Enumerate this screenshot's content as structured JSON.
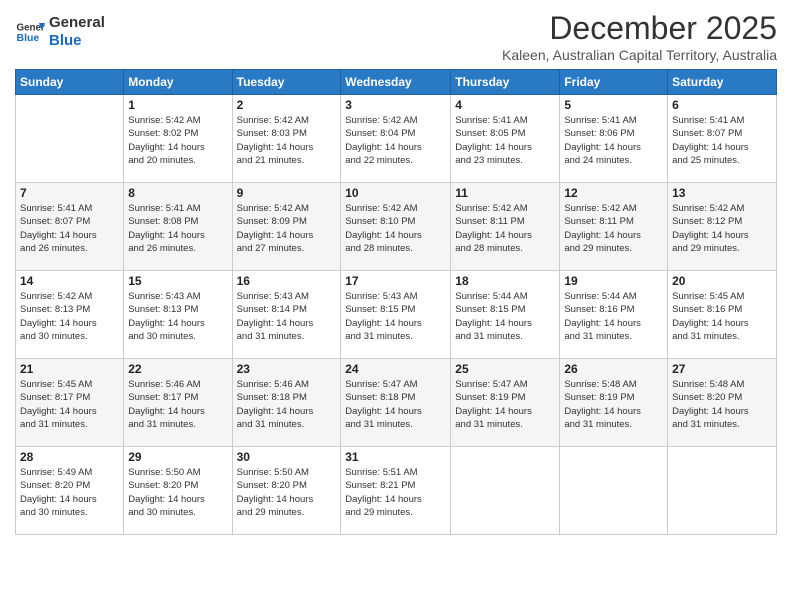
{
  "header": {
    "logo_line1": "General",
    "logo_line2": "Blue",
    "month_year": "December 2025",
    "location": "Kaleen, Australian Capital Territory, Australia"
  },
  "weekdays": [
    "Sunday",
    "Monday",
    "Tuesday",
    "Wednesday",
    "Thursday",
    "Friday",
    "Saturday"
  ],
  "weeks": [
    [
      {
        "day": "",
        "info": ""
      },
      {
        "day": "1",
        "info": "Sunrise: 5:42 AM\nSunset: 8:02 PM\nDaylight: 14 hours\nand 20 minutes."
      },
      {
        "day": "2",
        "info": "Sunrise: 5:42 AM\nSunset: 8:03 PM\nDaylight: 14 hours\nand 21 minutes."
      },
      {
        "day": "3",
        "info": "Sunrise: 5:42 AM\nSunset: 8:04 PM\nDaylight: 14 hours\nand 22 minutes."
      },
      {
        "day": "4",
        "info": "Sunrise: 5:41 AM\nSunset: 8:05 PM\nDaylight: 14 hours\nand 23 minutes."
      },
      {
        "day": "5",
        "info": "Sunrise: 5:41 AM\nSunset: 8:06 PM\nDaylight: 14 hours\nand 24 minutes."
      },
      {
        "day": "6",
        "info": "Sunrise: 5:41 AM\nSunset: 8:07 PM\nDaylight: 14 hours\nand 25 minutes."
      }
    ],
    [
      {
        "day": "7",
        "info": "Sunrise: 5:41 AM\nSunset: 8:07 PM\nDaylight: 14 hours\nand 26 minutes."
      },
      {
        "day": "8",
        "info": "Sunrise: 5:41 AM\nSunset: 8:08 PM\nDaylight: 14 hours\nand 26 minutes."
      },
      {
        "day": "9",
        "info": "Sunrise: 5:42 AM\nSunset: 8:09 PM\nDaylight: 14 hours\nand 27 minutes."
      },
      {
        "day": "10",
        "info": "Sunrise: 5:42 AM\nSunset: 8:10 PM\nDaylight: 14 hours\nand 28 minutes."
      },
      {
        "day": "11",
        "info": "Sunrise: 5:42 AM\nSunset: 8:11 PM\nDaylight: 14 hours\nand 28 minutes."
      },
      {
        "day": "12",
        "info": "Sunrise: 5:42 AM\nSunset: 8:11 PM\nDaylight: 14 hours\nand 29 minutes."
      },
      {
        "day": "13",
        "info": "Sunrise: 5:42 AM\nSunset: 8:12 PM\nDaylight: 14 hours\nand 29 minutes."
      }
    ],
    [
      {
        "day": "14",
        "info": "Sunrise: 5:42 AM\nSunset: 8:13 PM\nDaylight: 14 hours\nand 30 minutes."
      },
      {
        "day": "15",
        "info": "Sunrise: 5:43 AM\nSunset: 8:13 PM\nDaylight: 14 hours\nand 30 minutes."
      },
      {
        "day": "16",
        "info": "Sunrise: 5:43 AM\nSunset: 8:14 PM\nDaylight: 14 hours\nand 31 minutes."
      },
      {
        "day": "17",
        "info": "Sunrise: 5:43 AM\nSunset: 8:15 PM\nDaylight: 14 hours\nand 31 minutes."
      },
      {
        "day": "18",
        "info": "Sunrise: 5:44 AM\nSunset: 8:15 PM\nDaylight: 14 hours\nand 31 minutes."
      },
      {
        "day": "19",
        "info": "Sunrise: 5:44 AM\nSunset: 8:16 PM\nDaylight: 14 hours\nand 31 minutes."
      },
      {
        "day": "20",
        "info": "Sunrise: 5:45 AM\nSunset: 8:16 PM\nDaylight: 14 hours\nand 31 minutes."
      }
    ],
    [
      {
        "day": "21",
        "info": "Sunrise: 5:45 AM\nSunset: 8:17 PM\nDaylight: 14 hours\nand 31 minutes."
      },
      {
        "day": "22",
        "info": "Sunrise: 5:46 AM\nSunset: 8:17 PM\nDaylight: 14 hours\nand 31 minutes."
      },
      {
        "day": "23",
        "info": "Sunrise: 5:46 AM\nSunset: 8:18 PM\nDaylight: 14 hours\nand 31 minutes."
      },
      {
        "day": "24",
        "info": "Sunrise: 5:47 AM\nSunset: 8:18 PM\nDaylight: 14 hours\nand 31 minutes."
      },
      {
        "day": "25",
        "info": "Sunrise: 5:47 AM\nSunset: 8:19 PM\nDaylight: 14 hours\nand 31 minutes."
      },
      {
        "day": "26",
        "info": "Sunrise: 5:48 AM\nSunset: 8:19 PM\nDaylight: 14 hours\nand 31 minutes."
      },
      {
        "day": "27",
        "info": "Sunrise: 5:48 AM\nSunset: 8:20 PM\nDaylight: 14 hours\nand 31 minutes."
      }
    ],
    [
      {
        "day": "28",
        "info": "Sunrise: 5:49 AM\nSunset: 8:20 PM\nDaylight: 14 hours\nand 30 minutes."
      },
      {
        "day": "29",
        "info": "Sunrise: 5:50 AM\nSunset: 8:20 PM\nDaylight: 14 hours\nand 30 minutes."
      },
      {
        "day": "30",
        "info": "Sunrise: 5:50 AM\nSunset: 8:20 PM\nDaylight: 14 hours\nand 29 minutes."
      },
      {
        "day": "31",
        "info": "Sunrise: 5:51 AM\nSunset: 8:21 PM\nDaylight: 14 hours\nand 29 minutes."
      },
      {
        "day": "",
        "info": ""
      },
      {
        "day": "",
        "info": ""
      },
      {
        "day": "",
        "info": ""
      }
    ]
  ]
}
